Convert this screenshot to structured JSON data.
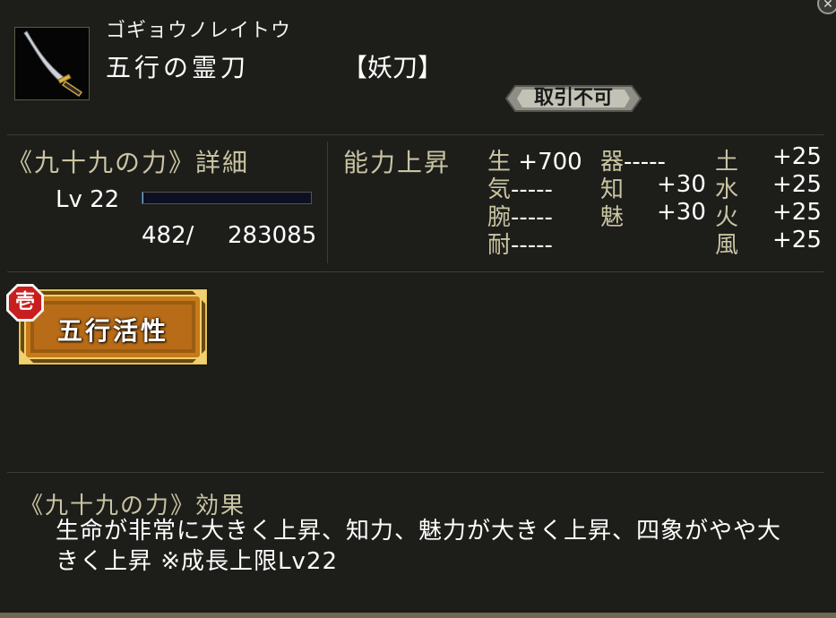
{
  "item": {
    "kana": "ゴギョウノレイトウ",
    "name": "五行の霊刀",
    "type": "【妖刀】",
    "trade_status": "取引不可"
  },
  "power": {
    "title": "《九十九の力》詳細",
    "level": "Lv 22",
    "exp_current": "482/",
    "exp_max": "283085",
    "exp_fraction": 0.0017
  },
  "ability": {
    "title": "能力上昇",
    "stats": [
      {
        "label": "生",
        "value": "+700"
      },
      {
        "label": "器",
        "value": "-----"
      },
      {
        "label": "土",
        "value": "+25"
      },
      {
        "label": "気",
        "value": "-----"
      },
      {
        "label": "知",
        "value": "+30"
      },
      {
        "label": "水",
        "value": "+25"
      },
      {
        "label": "腕",
        "value": "-----"
      },
      {
        "label": "魅",
        "value": "+30"
      },
      {
        "label": "火",
        "value": "+25"
      },
      {
        "label": "耐",
        "value": "-----"
      },
      {
        "label": "風",
        "value": "+25"
      }
    ]
  },
  "skill": {
    "mark": "壱",
    "label": "五行活性"
  },
  "effect": {
    "title": "《九十九の力》効果",
    "text": "生命が非常に大きく上昇、知力、魅力が大きく上昇、四象がやや大きく上昇 ※成長上限Lv22"
  },
  "colors": {
    "background": "#1d1d1a",
    "label_gold": "#c9c4a2",
    "text": "#ffffff",
    "badge": "#b8b8a8",
    "button_orange": "#d98c1a",
    "button_gold_frame": "#e0c25a",
    "mark_red": "#c81e1e"
  },
  "icons": {
    "close": "close-icon",
    "item": "katana-icon"
  }
}
